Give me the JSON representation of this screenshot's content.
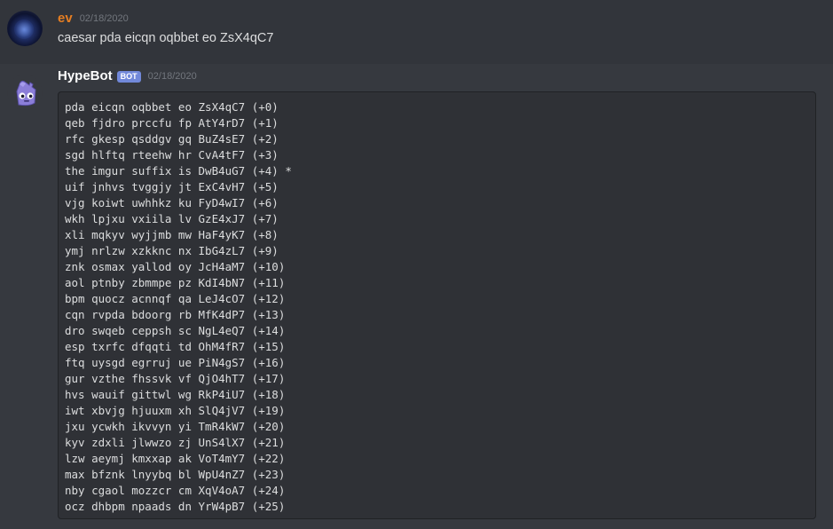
{
  "messages": [
    {
      "author": "ev",
      "timestamp": "02/18/2020",
      "content": "caesar pda eicqn oqbbet eo ZsX4qC7"
    },
    {
      "author": "HypeBot",
      "bot_tag": "BOT",
      "timestamp": "02/18/2020",
      "code_lines": [
        "pda eicqn oqbbet eo ZsX4qC7 (+0)",
        "qeb fjdro prccfu fp AtY4rD7 (+1)",
        "rfc gkesp qsddgv gq BuZ4sE7 (+2)",
        "sgd hlftq rteehw hr CvA4tF7 (+3)",
        "the imgur suffix is DwB4uG7 (+4) *",
        "uif jnhvs tvggjy jt ExC4vH7 (+5)",
        "vjg koiwt uwhhkz ku FyD4wI7 (+6)",
        "wkh lpjxu vxiila lv GzE4xJ7 (+7)",
        "xli mqkyv wyjjmb mw HaF4yK7 (+8)",
        "ymj nrlzw xzkknc nx IbG4zL7 (+9)",
        "znk osmax yallod oy JcH4aM7 (+10)",
        "aol ptnby zbmmpe pz KdI4bN7 (+11)",
        "bpm quocz acnnqf qa LeJ4cO7 (+12)",
        "cqn rvpda bdoorg rb MfK4dP7 (+13)",
        "dro swqeb ceppsh sc NgL4eQ7 (+14)",
        "esp txrfc dfqqti td OhM4fR7 (+15)",
        "ftq uysgd egrruj ue PiN4gS7 (+16)",
        "gur vzthe fhssvk vf QjO4hT7 (+17)",
        "hvs wauif gittwl wg RkP4iU7 (+18)",
        "iwt xbvjg hjuuxm xh SlQ4jV7 (+19)",
        "jxu ycwkh ikvvyn yi TmR4kW7 (+20)",
        "kyv zdxli jlwwzo zj UnS4lX7 (+21)",
        "lzw aeymj kmxxap ak VoT4mY7 (+22)",
        "max bfznk lnyybq bl WpU4nZ7 (+23)",
        "nby cgaol mozzcr cm XqV4oA7 (+24)",
        "ocz dhbpm npaads dn YrW4pB7 (+25)"
      ]
    }
  ]
}
